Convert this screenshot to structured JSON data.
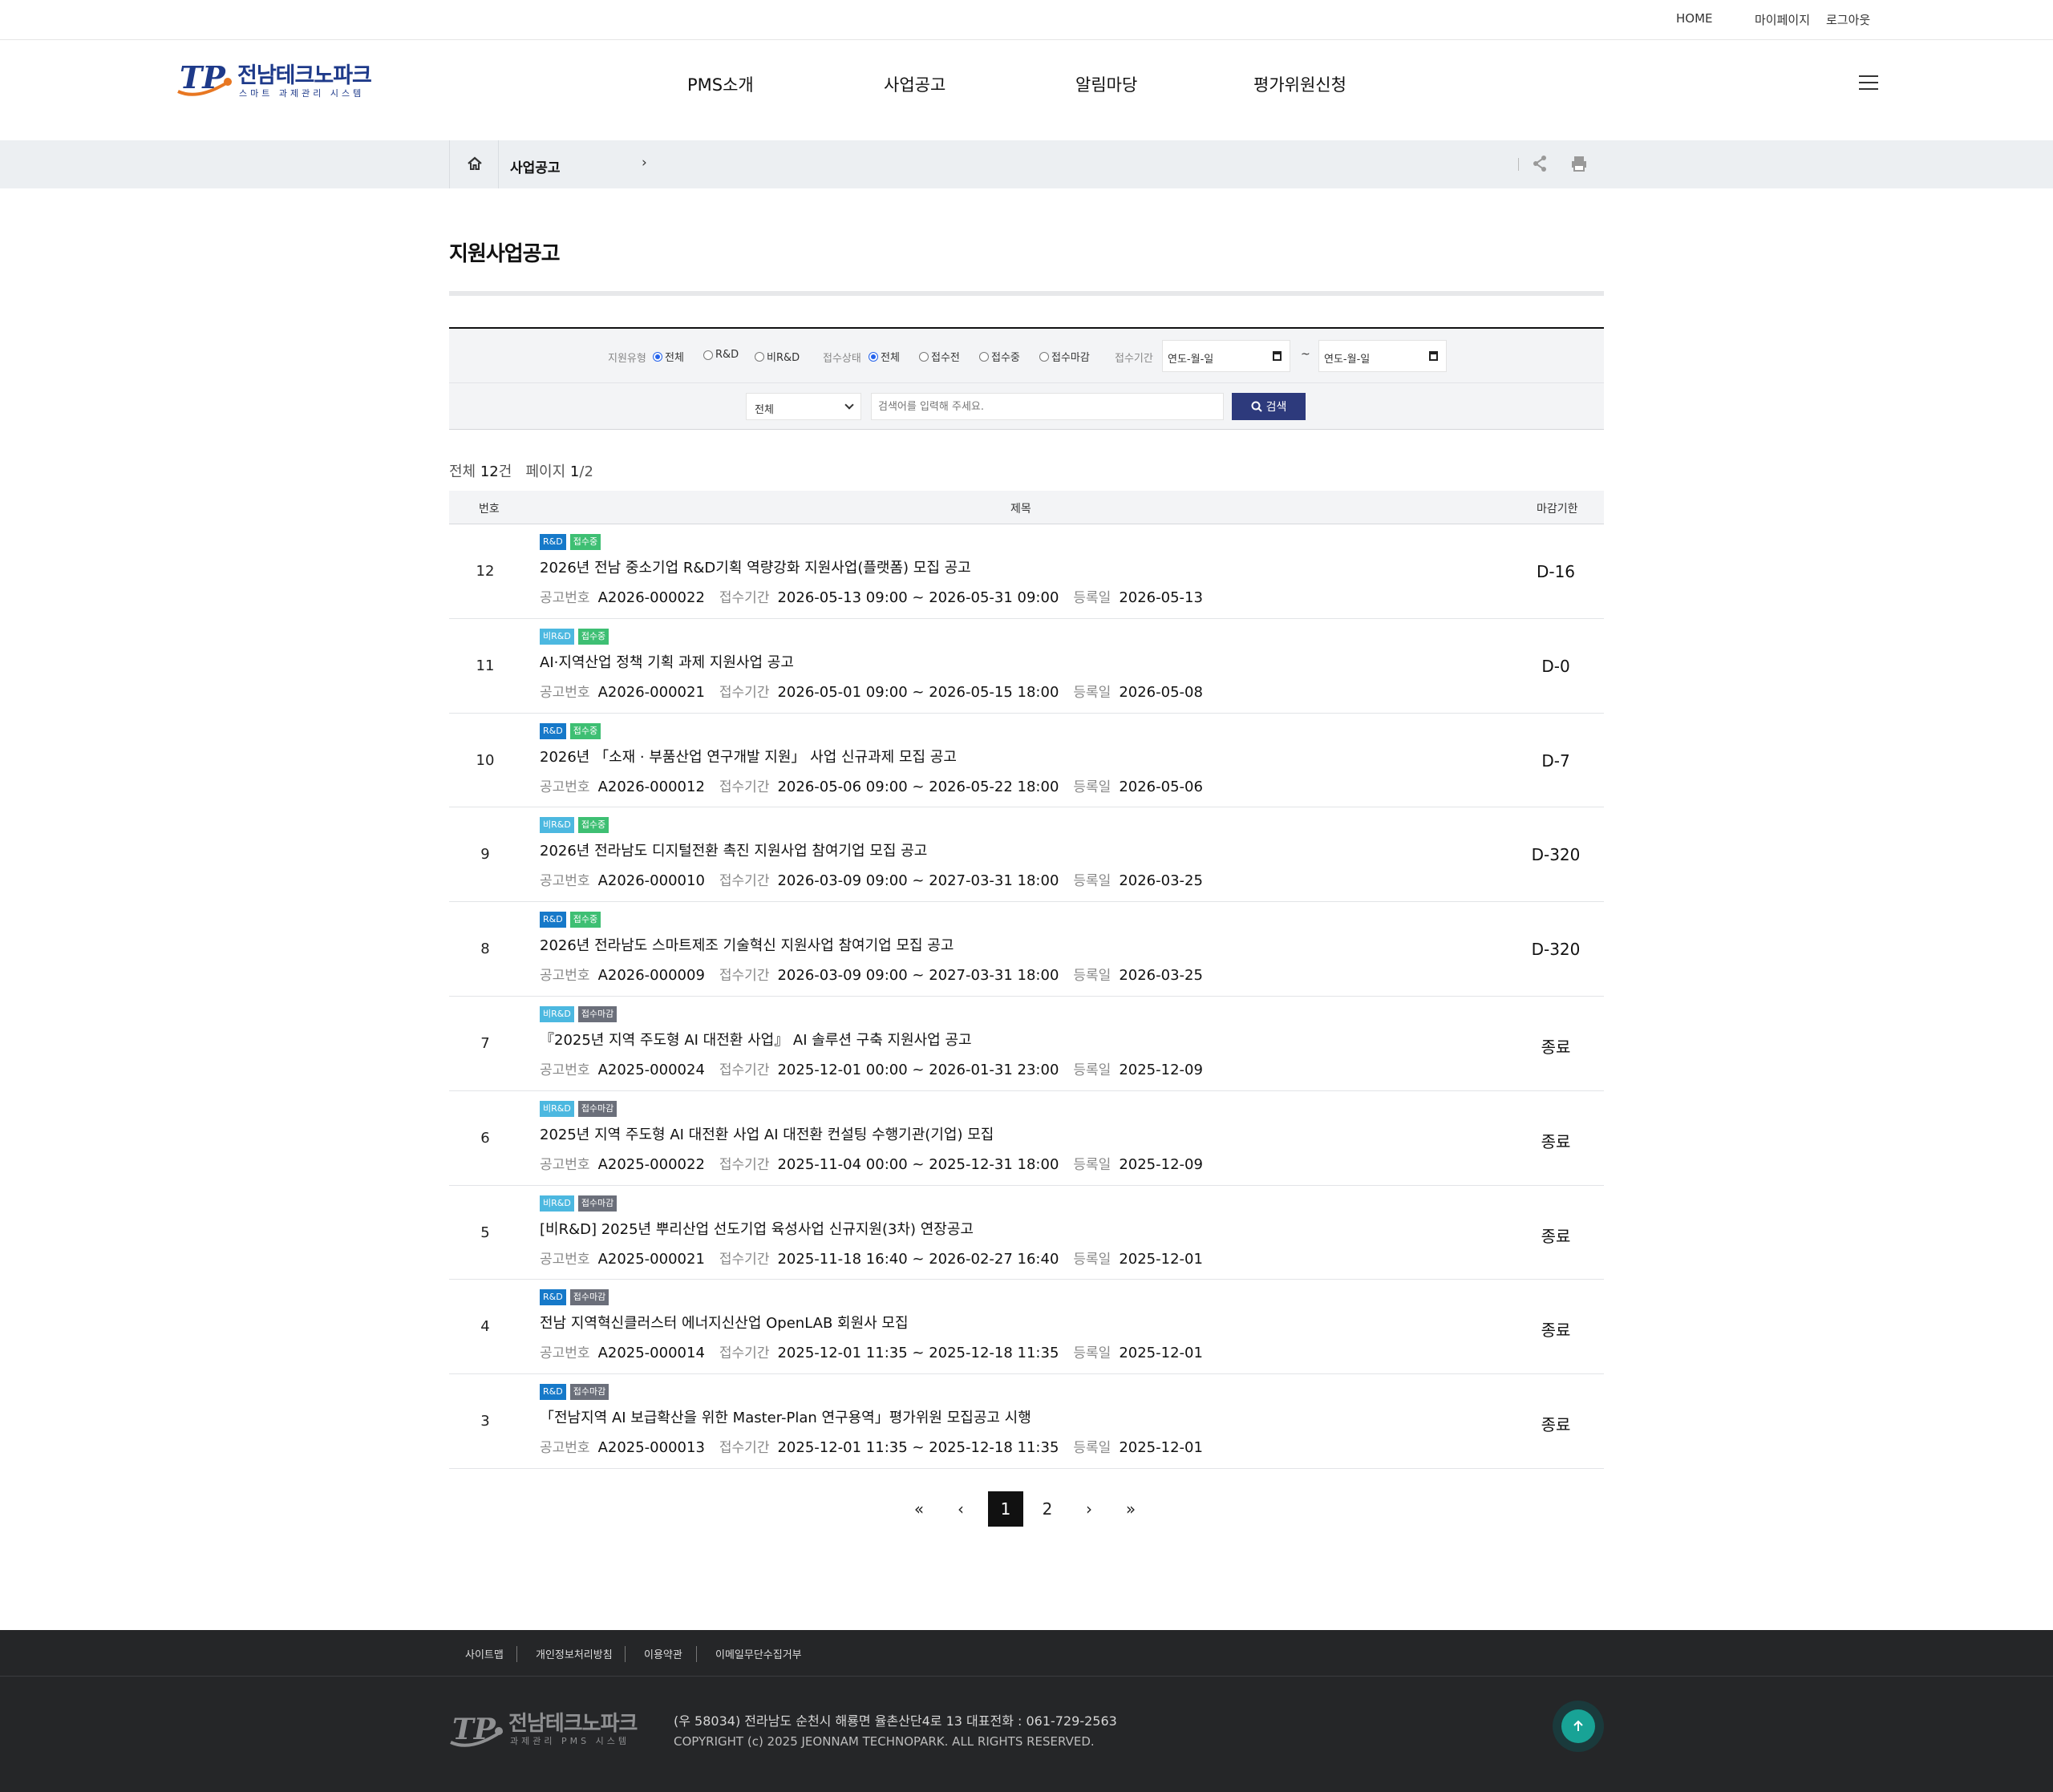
{
  "util": {
    "home": "HOME",
    "mypage": "마이페이지",
    "logout": "로그아웃"
  },
  "brand": {
    "name": "전남테크노파크",
    "sub": "스마트 과제관리 시스템",
    "mark": "TP",
    "color": "#1e3a8a",
    "accent": "#e87722"
  },
  "gnb": [
    "PMS소개",
    "사업공고",
    "알림마당",
    "평가위원신청"
  ],
  "breadcrumb": {
    "current": "사업공고"
  },
  "page_title": "지원사업공고",
  "search": {
    "type_label": "지원유형",
    "type_options": [
      "전체",
      "R&D",
      "비R&D"
    ],
    "status_label": "접수상태",
    "status_options": [
      "전체",
      "접수전",
      "접수중",
      "접수마감"
    ],
    "period_label": "접수기간",
    "date_placeholder": "연도-월-일",
    "tilde": "~",
    "select_value": "전체",
    "keyword_placeholder": "검색어를 입력해 주세요.",
    "button": "검색"
  },
  "summary": {
    "total_prefix": "전체",
    "total": "12",
    "total_suffix": "건",
    "page_prefix": "페이지",
    "page_current": "1",
    "page_total": "/2"
  },
  "table": {
    "headers": {
      "num": "번호",
      "title": "제목",
      "deadline": "마감기한"
    },
    "meta_labels": {
      "no": "공고번호",
      "period": "접수기간",
      "reg": "등록일"
    },
    "rows": [
      {
        "num": "12",
        "type": "R&D",
        "status": "접수중",
        "title": "2026년 전남 중소기업 R&D기획 역량강화 지원사업(플랫폼) 모집 공고",
        "no": "A2026-000022",
        "period": "2026-05-13 09:00 ~ 2026-05-31 09:00",
        "reg": "2026-05-13",
        "deadline": "D-16"
      },
      {
        "num": "11",
        "type": "비R&D",
        "status": "접수중",
        "title": "AI·지역산업 정책 기획 과제 지원사업 공고",
        "no": "A2026-000021",
        "period": "2026-05-01 09:00 ~ 2026-05-15 18:00",
        "reg": "2026-05-08",
        "deadline": "D-0"
      },
      {
        "num": "10",
        "type": "R&D",
        "status": "접수중",
        "title": "2026년 「소재 · 부품산업 연구개발 지원」 사업 신규과제 모집 공고",
        "no": "A2026-000012",
        "period": "2026-05-06 09:00 ~ 2026-05-22 18:00",
        "reg": "2026-05-06",
        "deadline": "D-7"
      },
      {
        "num": "9",
        "type": "비R&D",
        "status": "접수중",
        "title": "2026년 전라남도 디지털전환 촉진 지원사업 참여기업 모집 공고",
        "no": "A2026-000010",
        "period": "2026-03-09 09:00 ~ 2027-03-31 18:00",
        "reg": "2026-03-25",
        "deadline": "D-320"
      },
      {
        "num": "8",
        "type": "R&D",
        "status": "접수중",
        "title": "2026년 전라남도 스마트제조 기술혁신 지원사업 참여기업 모집 공고",
        "no": "A2026-000009",
        "period": "2026-03-09 09:00 ~ 2027-03-31 18:00",
        "reg": "2026-03-25",
        "deadline": "D-320"
      },
      {
        "num": "7",
        "type": "비R&D",
        "status": "접수마감",
        "title": "『2025년 지역 주도형 AI 대전환 사업』 AI 솔루션 구축 지원사업 공고",
        "no": "A2025-000024",
        "period": "2025-12-01 00:00 ~ 2026-01-31 23:00",
        "reg": "2025-12-09",
        "deadline": "종료"
      },
      {
        "num": "6",
        "type": "비R&D",
        "status": "접수마감",
        "title": "2025년 지역 주도형 AI 대전환 사업 AI 대전환 컨설팅 수행기관(기업) 모집",
        "no": "A2025-000022",
        "period": "2025-11-04 00:00 ~ 2025-12-31 18:00",
        "reg": "2025-12-09",
        "deadline": "종료"
      },
      {
        "num": "5",
        "type": "비R&D",
        "status": "접수마감",
        "title": "[비R&D] 2025년 뿌리산업 선도기업 육성사업 신규지원(3차) 연장공고",
        "no": "A2025-000021",
        "period": "2025-11-18 16:40 ~ 2026-02-27 16:40",
        "reg": "2025-12-01",
        "deadline": "종료"
      },
      {
        "num": "4",
        "type": "R&D",
        "status": "접수마감",
        "title": "전남 지역혁신클러스터 에너지신산업 OpenLAB 회원사 모집",
        "no": "A2025-000014",
        "period": "2025-12-01 11:35 ~ 2025-12-18 11:35",
        "reg": "2025-12-01",
        "deadline": "종료"
      },
      {
        "num": "3",
        "type": "R&D",
        "status": "접수마감",
        "title": "「전남지역 AI 보급확산을 위한 Master-Plan 연구용역」평가위원 모집공고 시행",
        "no": "A2025-000013",
        "period": "2025-12-01 11:35 ~ 2025-12-18 11:35",
        "reg": "2025-12-01",
        "deadline": "종료"
      }
    ]
  },
  "badge_colors": {
    "R&D": "#1679c9",
    "비R&D": "#4cb8e0",
    "접수중": "#3ebf73",
    "접수마감": "#6b6f7a"
  },
  "pagination": {
    "first": "«",
    "prev": "‹",
    "pages": [
      "1",
      "2"
    ],
    "current": "1",
    "next": "›",
    "last": "»"
  },
  "footer": {
    "links": [
      "사이트맵",
      "개인정보처리방침",
      "이용약관",
      "이메일무단수집거부"
    ],
    "logo_name": "전남테크노파크",
    "logo_sub": "과제관리 PMS 시스템",
    "address": "(우 58034) 전라남도 순천시 해룡면 율촌산단4로 13    대표전화 : 061-729-2563",
    "copyright": "COPYRIGHT (c) 2025 JEONNAM TECHNOPARK. ALL RIGHTS RESERVED."
  }
}
